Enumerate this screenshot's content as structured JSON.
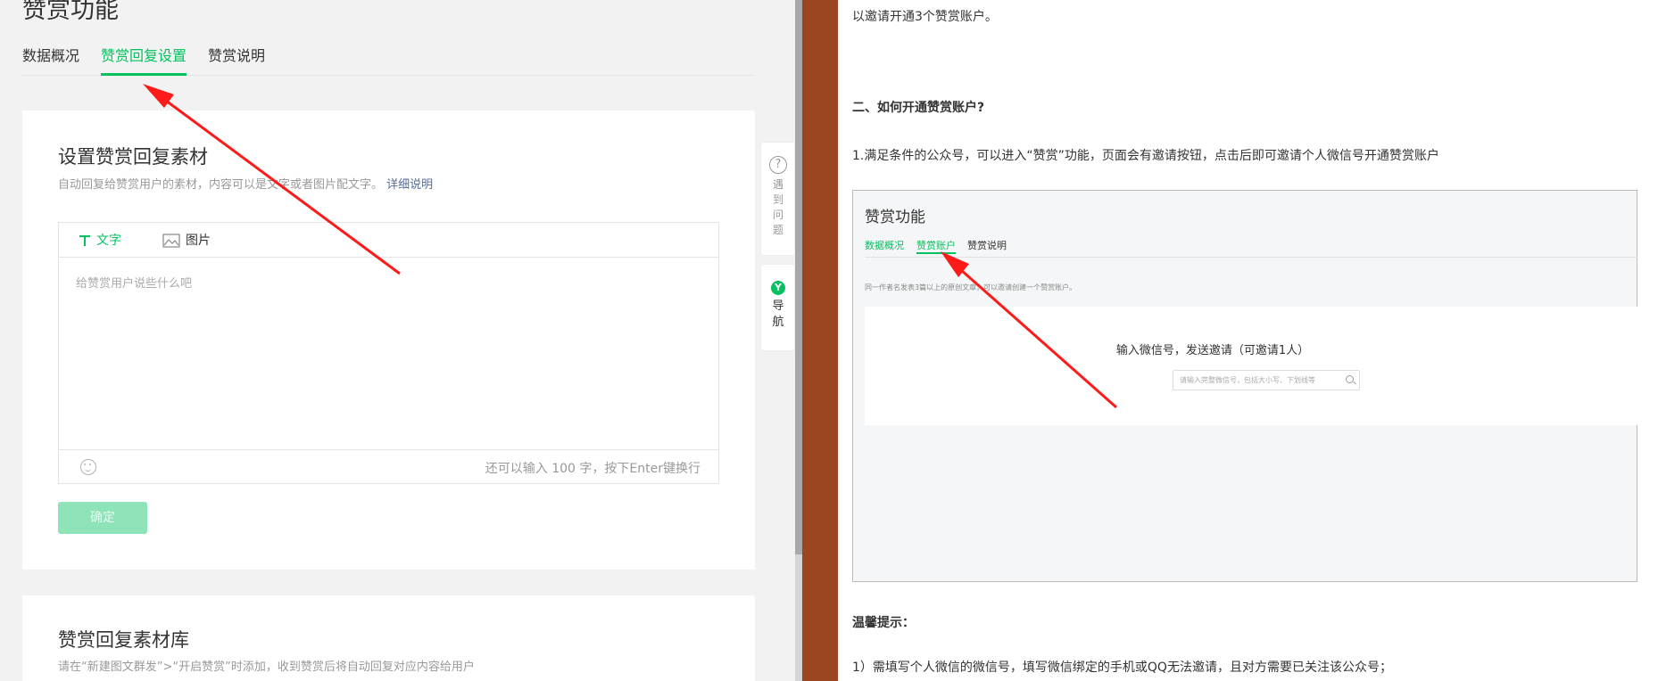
{
  "left": {
    "page_title": "赞赏功能",
    "tabs": [
      {
        "label": "数据概况"
      },
      {
        "label": "赞赏回复设置"
      },
      {
        "label": "赞赏说明"
      }
    ],
    "reply_section": {
      "title": "设置赞赏回复素材",
      "desc": "自动回复给赞赏用户的素材，内容可以是文字或者图片配文字。",
      "detail_link": "详细说明",
      "editor_tabs": [
        {
          "label": "文字",
          "icon": "text-icon"
        },
        {
          "label": "图片",
          "icon": "image-icon"
        }
      ],
      "placeholder": "给赞赏用户说些什么吧",
      "counter": "还可以输入 100 字，按下Enter键换行",
      "confirm_label": "确定"
    },
    "library_section": {
      "title": "赞赏回复素材库",
      "desc": "请在“新建图文群发”>“开启赞赏”时添加，收到赞赏后将自动回复对应内容给用户"
    },
    "side_widgets": {
      "help": "遇到问题",
      "help_symbol": "?",
      "nav": "导航",
      "nav_symbol": "Y"
    }
  },
  "right": {
    "line_top": "以邀请开通3个赞赏账户。",
    "heading_2": "二、如何开通赞赏账户?",
    "step_1": "1.满足条件的公众号，可以进入“赞赏”功能，页面会有邀请按钮，点击后即可邀请个人微信号开通赞赏账户",
    "screenshot": {
      "title": "赞赏功能",
      "tabs": [
        "数据概况",
        "赞赏账户",
        "赞赏说明"
      ],
      "note": "同一作者名发表3篇以上的原创文章，可以邀请创建一个赞赏账户。",
      "card_title": "输入微信号，发送邀请（可邀请1人）",
      "input_placeholder": "请输入完整微信号，包括大小写、下划线等"
    },
    "tips_heading": "温馨提示：",
    "tip_1": "1）需填写个人微信的微信号，填写微信绑定的手机或QQ无法邀请，且对方需要已关注该公众号；"
  },
  "colors": {
    "accent": "#07c160",
    "link": "#576b95",
    "divider": "#9c4521",
    "arrow": "#ff1a1a"
  }
}
